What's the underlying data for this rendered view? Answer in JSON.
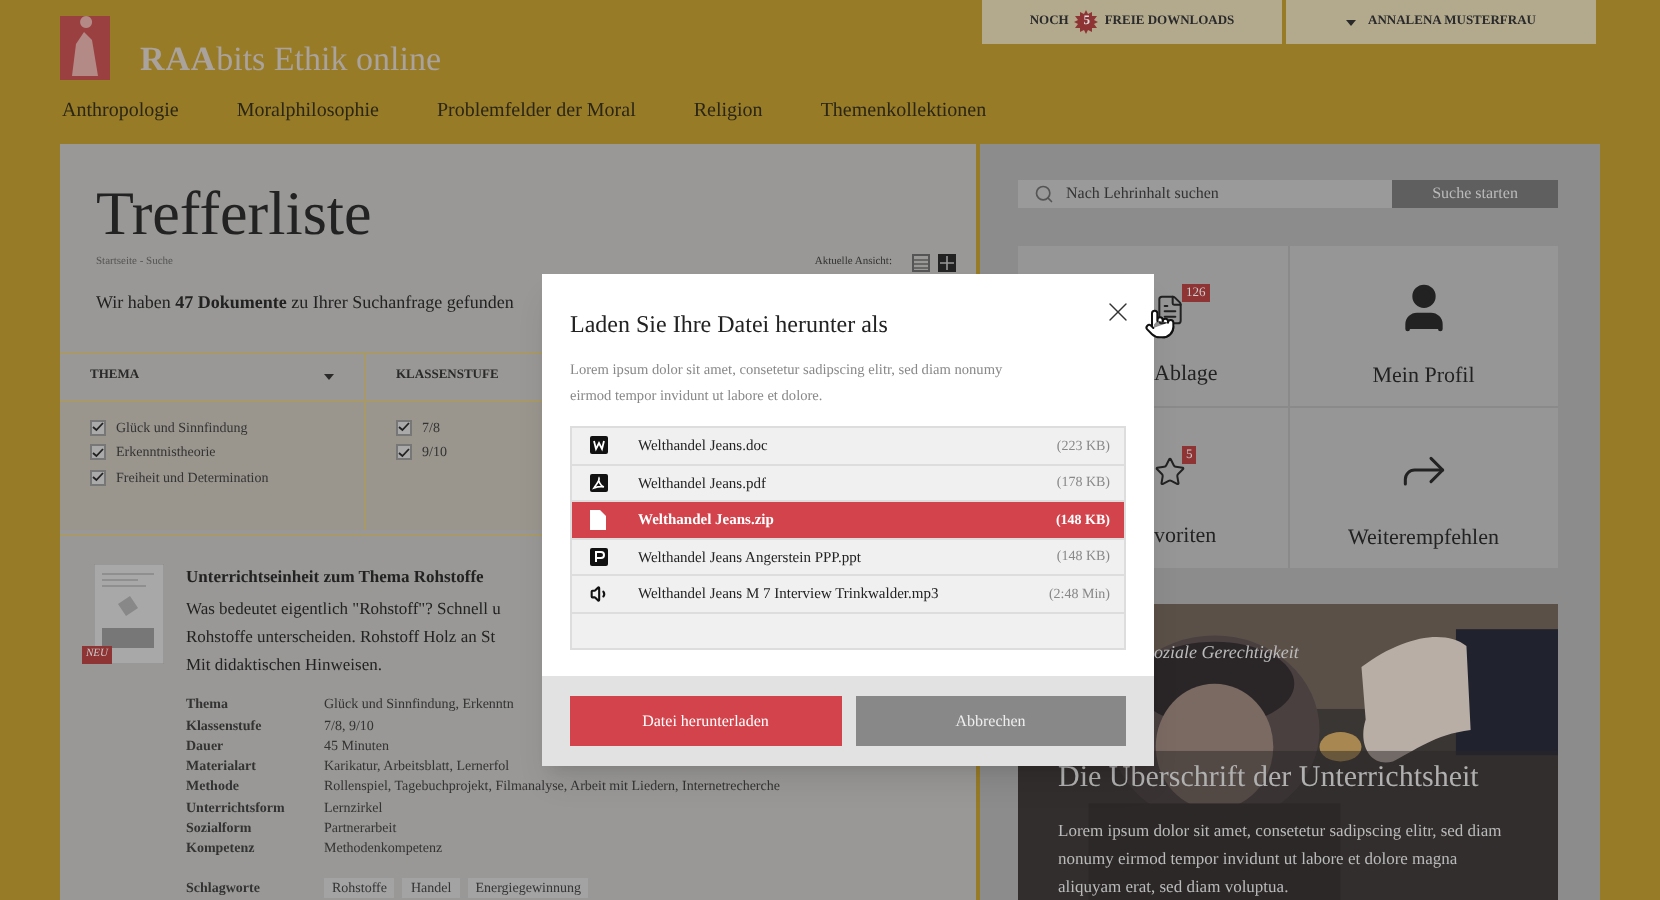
{
  "header": {
    "logo_bold": "RAA",
    "logo_rest": "bits Ethik online",
    "downloads": {
      "before": "NOCH",
      "count": "5",
      "after": "FREIE DOWNLOADS"
    },
    "user": "ANNALENA MUSTERFRAU"
  },
  "nav": [
    "Anthropologie",
    "Moralphilosophie",
    "Problemfelder der Moral",
    "Religion",
    "Themenkollektionen"
  ],
  "results": {
    "title": "Trefferliste",
    "breadcrumb": "Startseite - Suche",
    "view_label": "Aktuelle Ansicht:",
    "views": [
      {
        "kind": "list",
        "selected": false
      },
      {
        "kind": "tiles",
        "selected": true
      }
    ],
    "summary": "Wir haben **47 Dokumente** zu Ihrer Suchanfrage gefunden",
    "filters": [
      {
        "label": "THEMA",
        "dropdown": true,
        "options": [
          {
            "label": "Glück und Sinnfindung",
            "checked": true
          },
          {
            "label": "Erkenntnistheorie",
            "checked": true
          },
          {
            "label": "Freiheit und Determination",
            "checked": true
          }
        ]
      },
      {
        "label": "KLASSENSTUFE",
        "options": [
          {
            "label": "7/8",
            "checked": true
          },
          {
            "label": "9/10",
            "checked": true
          }
        ]
      }
    ],
    "item": {
      "badge": "NEU",
      "title": "Unterrichtseinheit zum Thema Rohstoffe",
      "description": [
        "Was bedeutet eigentlich \"Rohstoff\"? Schnell u",
        "Rohstoffe unterscheiden. Rohstoff Holz an St",
        "Mit didaktischen Hinweisen."
      ],
      "details": [
        {
          "label": "Thema",
          "value": "Glück und Sinnfindung, Erkenntn"
        },
        {
          "label": "Klassenstufe",
          "value": "7/8, 9/10"
        },
        {
          "label": "Dauer",
          "value": "45 Minuten"
        },
        {
          "label": "Materialart",
          "value": "Karikatur, Arbeitsblatt, Lernerfol"
        },
        {
          "label": "Methode",
          "value": "Rollenspiel, Tagebuchprojekt, Filmanalyse, Arbeit mit Liedern, Internetrecherche"
        },
        {
          "label": "Unterrichtsform",
          "value": "Lernzirkel"
        },
        {
          "label": "Sozialform",
          "value": "Partnerarbeit"
        },
        {
          "label": "Kompetenz",
          "value": "Methodenkompetenz"
        }
      ],
      "tags_label": "Schlagworte",
      "tags": [
        "Rohstoffe",
        "Handel",
        "Energiegewinnung"
      ]
    }
  },
  "sidebar": {
    "search": {
      "placeholder": "Nach Lehrinhalt suchen",
      "button": "Suche starten"
    },
    "tiles": [
      {
        "kind": "storage",
        "label": "Ablage",
        "badge": "126"
      },
      {
        "kind": "profile",
        "label": "Mein Profil"
      },
      {
        "kind": "favorites",
        "label": "voriten",
        "badge": "5"
      },
      {
        "kind": "share",
        "label": "Weiterempfehlen"
      }
    ],
    "feature": {
      "category": "oziale Gerechtigkeit",
      "headline": "Die Überschrift der Unterrichtsheit",
      "text": "Lorem ipsum dolor sit amet, consetetur sadipscing elitr, sed diam nonumy eirmod tempor invidunt ut labore et dolore magna aliquyam erat, sed diam voluptua."
    }
  },
  "modal": {
    "title": "Laden Sie Ihre Datei herunter als",
    "text": "Lorem ipsum dolor sit amet, consetetur sadipscing elitr, sed diam nonumy eirmod tempor invidunt ut labore et dolore.",
    "files": [
      {
        "kind": "doc",
        "name": "Welthandel Jeans.doc",
        "size": "(223 KB)",
        "selected": false
      },
      {
        "kind": "pdf",
        "name": "Welthandel Jeans.pdf",
        "size": "(178 KB)",
        "selected": false
      },
      {
        "kind": "zip",
        "name": "Welthandel Jeans.zip",
        "size": "(148 KB)",
        "selected": true
      },
      {
        "kind": "ppt",
        "name": "Welthandel Jeans Angerstein PPP.ppt",
        "size": "(148 KB)",
        "selected": false
      },
      {
        "kind": "audio",
        "name": "Welthandel Jeans M 7 Interview Trinkwalder.mp3",
        "size": "(2:48 Min)",
        "selected": false
      }
    ],
    "primary": "Datei herunterladen",
    "secondary": "Abbrechen"
  }
}
